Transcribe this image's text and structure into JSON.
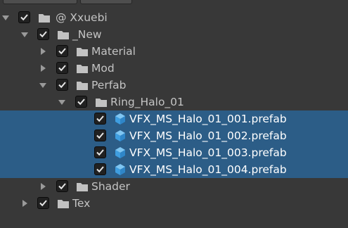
{
  "colors": {
    "background": "#383838",
    "selection": "#2c5d87",
    "text": "#c4c4c4",
    "selected_text": "#ffffff",
    "folder": "#c2c2c2",
    "prefab_cube": "#4aa9e6"
  },
  "tree": {
    "rows": [
      {
        "label": "@ Xxuebi",
        "icon": "folder-icon",
        "expanded": true,
        "checked": true,
        "selected": false
      },
      {
        "label": "_New",
        "icon": "folder-icon",
        "expanded": true,
        "checked": true,
        "selected": false
      },
      {
        "label": "Material",
        "icon": "folder-icon",
        "expanded": false,
        "checked": true,
        "selected": false
      },
      {
        "label": "Mod",
        "icon": "folder-icon",
        "expanded": false,
        "checked": true,
        "selected": false
      },
      {
        "label": "Perfab",
        "icon": "folder-icon",
        "expanded": true,
        "checked": true,
        "selected": false
      },
      {
        "label": "Ring_Halo_01",
        "icon": "folder-icon",
        "expanded": true,
        "checked": true,
        "selected": false
      },
      {
        "label": "VFX_MS_Halo_01_001.prefab",
        "icon": "prefab-cube-icon",
        "checked": true,
        "selected": true
      },
      {
        "label": "VFX_MS_Halo_01_002.prefab",
        "icon": "prefab-cube-icon",
        "checked": true,
        "selected": true
      },
      {
        "label": "VFX_MS_Halo_01_003.prefab",
        "icon": "prefab-cube-icon",
        "checked": true,
        "selected": true
      },
      {
        "label": "VFX_MS_Halo_01_004.prefab",
        "icon": "prefab-cube-icon",
        "checked": true,
        "selected": true
      },
      {
        "label": "Shader",
        "icon": "folder-icon",
        "expanded": false,
        "checked": true,
        "selected": false
      },
      {
        "label": "Tex",
        "icon": "folder-icon",
        "expanded": false,
        "checked": true,
        "selected": false
      }
    ]
  }
}
